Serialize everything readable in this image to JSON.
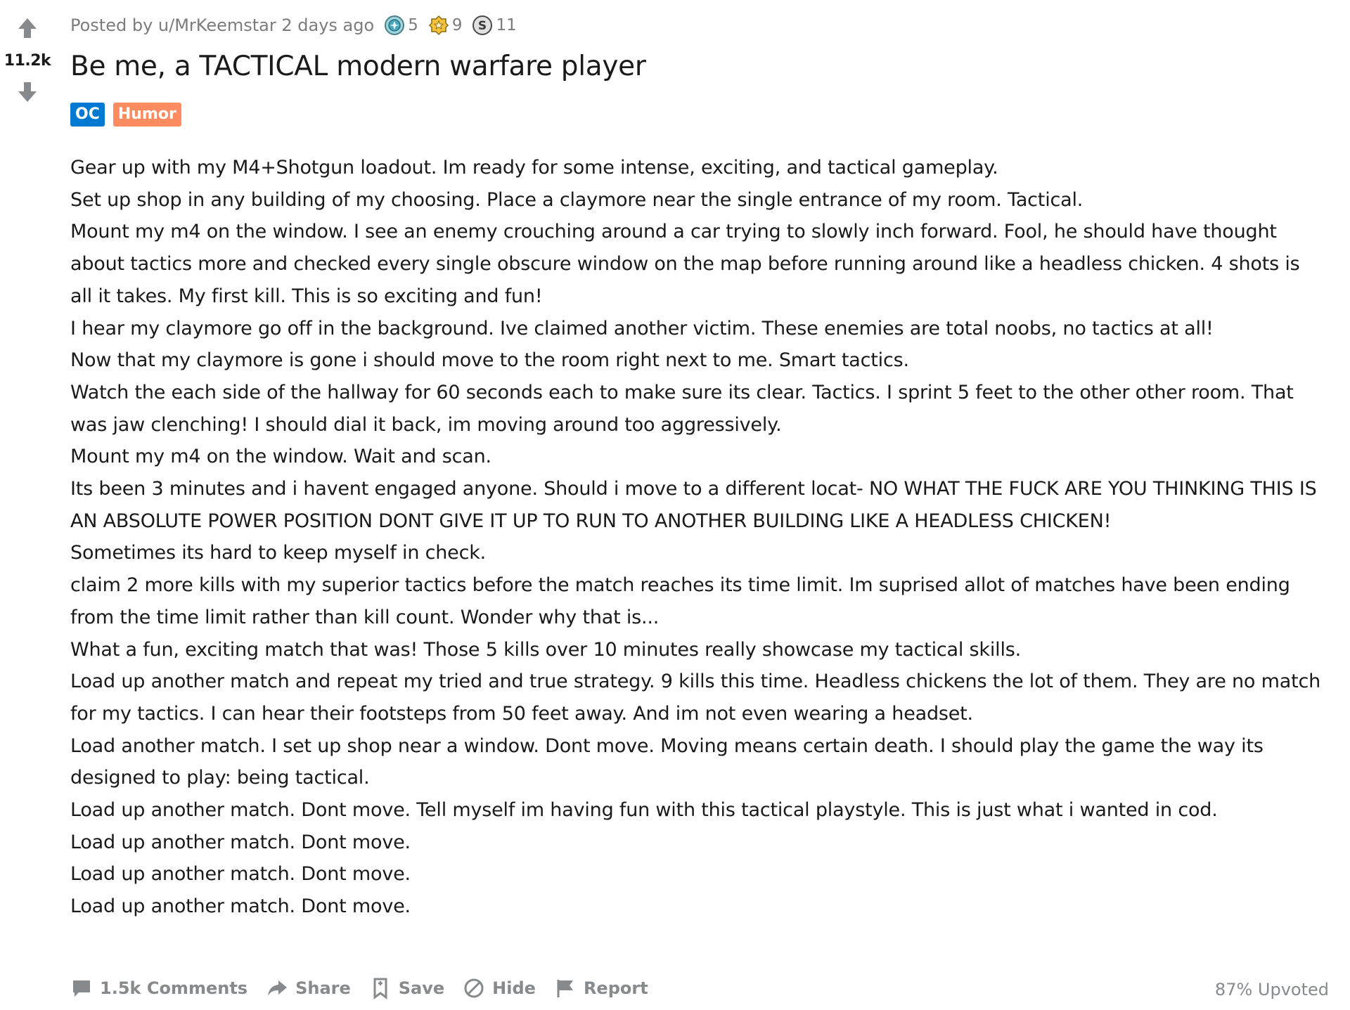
{
  "post": {
    "score": "11.2k",
    "meta": {
      "posted_by": "Posted by",
      "author": "u/MrKeemstar",
      "time": "2 days ago"
    },
    "awards": [
      {
        "icon": "silver-award-icon",
        "count": "5"
      },
      {
        "icon": "gold-award-icon",
        "count": "9"
      },
      {
        "icon": "coin-award-icon",
        "count": "11"
      }
    ],
    "title": "Be me, a TACTICAL modern warfare player",
    "flairs": [
      {
        "label": "OC",
        "color": "#0079d3"
      },
      {
        "label": "Humor",
        "color": "#ff8b60"
      }
    ],
    "body": [
      "Gear up with my M4+Shotgun loadout. Im ready for some intense, exciting, and tactical gameplay.",
      "Set up shop in any building of my choosing. Place a claymore near the single entrance of my room. Tactical.",
      "Mount my m4 on the window. I see an enemy crouching around a car trying to slowly inch forward. Fool, he should have thought about tactics more and checked every single obscure window on the map before running around like a headless chicken. 4 shots is all it takes. My first kill. This is so exciting and fun!",
      "I hear my claymore go off in the background. Ive claimed another victim. These enemies are total noobs, no tactics at all!",
      "Now that my claymore is gone i should move to the room right next to me. Smart tactics.",
      "Watch the each side of the hallway for 60 seconds each to make sure its clear. Tactics. I sprint 5 feet to the other other room. That was jaw clenching! I should dial it back, im moving around too aggressively.",
      "Mount my m4 on the window. Wait and scan.",
      "Its been 3 minutes and i havent engaged anyone. Should i move to a different locat- NO WHAT THE FUCK ARE YOU THINKING THIS IS AN ABSOLUTE POWER POSITION DONT GIVE IT UP TO RUN TO ANOTHER BUILDING LIKE A HEADLESS CHICKEN!",
      "Sometimes its hard to keep myself in check.",
      "claim 2 more kills with my superior tactics before the match reaches its time limit. Im suprised allot of matches have been ending from the time limit rather than kill count. Wonder why that is...",
      "What a fun, exciting match that was! Those 5 kills over 10 minutes really showcase my tactical skills.",
      "Load up another match and repeat my tried and true strategy. 9 kills this time. Headless chickens the lot of them. They are no match for my tactics. I can hear their footsteps from 50 feet away. And im not even wearing a headset.",
      "Load another match. I set up shop near a window. Dont move. Moving means certain death. I should play the game the way its designed to play: being tactical.",
      "Load up another match. Dont move. Tell myself im having fun with this tactical playstyle. This is just what i wanted in cod.",
      "Load up another match. Dont move.",
      "Load up another match. Dont move.",
      "Load up another match. Dont move."
    ],
    "actions": {
      "comments": "1.5k Comments",
      "share": "Share",
      "save": "Save",
      "hide": "Hide",
      "report": "Report"
    },
    "upvoted": "87% Upvoted"
  },
  "colors": {
    "text": "#1a1a1b",
    "meta": "#7c7c7c",
    "action": "#878a8c",
    "vote_arrow": "#878a8c"
  }
}
